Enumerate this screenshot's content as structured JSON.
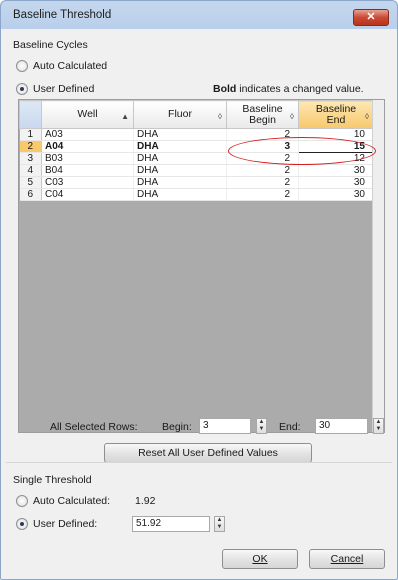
{
  "window": {
    "title": "Baseline Threshold",
    "close_glyph": "✕"
  },
  "baseline_cycles": {
    "heading": "Baseline Cycles",
    "auto_label": "Auto Calculated",
    "user_label": "User Defined",
    "selected": "user",
    "note_bold": "Bold",
    "note_rest": " indicates a changed value."
  },
  "grid": {
    "columns": [
      {
        "label": "",
        "sort": ""
      },
      {
        "label": "Well",
        "sort": "▲"
      },
      {
        "label": "Fluor",
        "sort": "◊"
      },
      {
        "label": "Baseline Begin",
        "sort": "◊"
      },
      {
        "label": "Baseline End",
        "sort": "◊"
      }
    ],
    "rows": [
      {
        "num": "1",
        "well": "A03",
        "fluor": "DHA",
        "begin": "2",
        "end": "10",
        "changed": false
      },
      {
        "num": "2",
        "well": "A04",
        "fluor": "DHA",
        "begin": "3",
        "end": "15",
        "changed": true
      },
      {
        "num": "3",
        "well": "B03",
        "fluor": "DHA",
        "begin": "2",
        "end": "12",
        "changed": false
      },
      {
        "num": "4",
        "well": "B04",
        "fluor": "DHA",
        "begin": "2",
        "end": "30",
        "changed": false
      },
      {
        "num": "5",
        "well": "C03",
        "fluor": "DHA",
        "begin": "2",
        "end": "30",
        "changed": false
      },
      {
        "num": "6",
        "well": "C04",
        "fluor": "DHA",
        "begin": "2",
        "end": "30",
        "changed": false
      }
    ]
  },
  "all_selected": {
    "label": "All Selected Rows:",
    "begin_label": "Begin:",
    "begin_value": "3",
    "end_label": "End:",
    "end_value": "30"
  },
  "reset_button": "Reset All User Defined Values",
  "single_threshold": {
    "heading": "Single Threshold",
    "auto_label": "Auto Calculated:",
    "auto_value": "1.92",
    "user_label": "User Defined:",
    "user_value": "51.92",
    "selected": "user"
  },
  "buttons": {
    "ok": "OK",
    "cancel": "Cancel"
  },
  "colors": {
    "accent_header": "#f8c86c",
    "annotation": "#d62020"
  },
  "icons": {
    "spin_up": "▲",
    "spin_down": "▼"
  }
}
